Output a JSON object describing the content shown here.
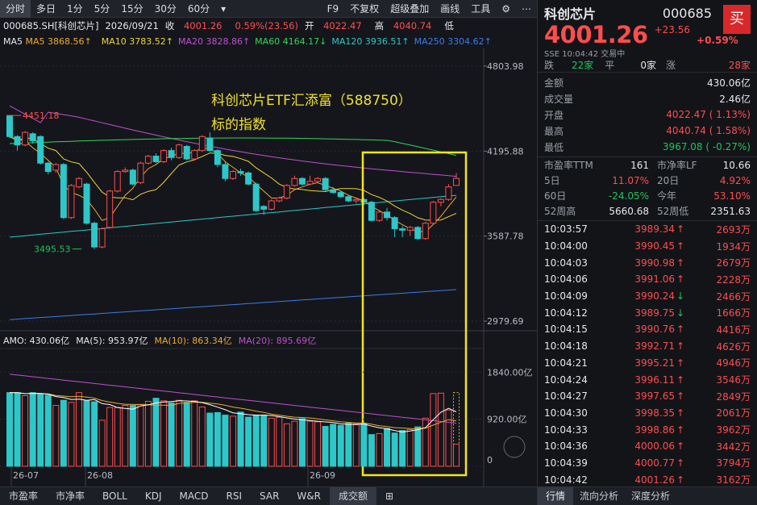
{
  "toolbar": {
    "periods": [
      "分时",
      "多日",
      "1分",
      "5分",
      "15分",
      "30分",
      "60分"
    ],
    "f9": "F9",
    "fq": "不复权",
    "overlay": "超级叠加",
    "draw": "画线",
    "tools": "工具",
    "gear": "⚙",
    "more": "⋯"
  },
  "info": {
    "code": "000685.SH[科创芯片]",
    "date": "2026/09/21",
    "close_label": "收",
    "close": "4001.26",
    "pct": "0.59%(23.56)",
    "open_label": "开",
    "open": "4022.47",
    "high_label": "高",
    "high": "4040.74",
    "low_label": "低"
  },
  "ma": {
    "ma5": "MA5 3868.56↑",
    "ma10": "MA10 3783.52↑",
    "ma20": "MA20 3828.86↑",
    "ma60": "MA60 4164.17↓",
    "ma120": "MA120 3936.51↑",
    "ma250": "MA250 3304.62↑"
  },
  "annotation": {
    "line1": "科创芯片ETF汇添富（588750）",
    "line2": "标的指数"
  },
  "chart_data": {
    "type": "candlestick",
    "y_ticks": [
      "4803.98",
      "4195.88",
      "3587.78",
      "2979.69"
    ],
    "y_values": [
      4803.98,
      4195.88,
      3587.78,
      2979.69
    ],
    "price_labels": {
      "max": "4451.18",
      "min": "3495.53"
    },
    "max_value": 4451.18,
    "min_value": 3495.53,
    "x_labels": [
      "26-07",
      "26-08",
      "26-09"
    ],
    "candles": [
      [
        4450,
        4300,
        4451,
        4290
      ],
      [
        4300,
        4240,
        4310,
        4200
      ],
      [
        4240,
        4330,
        4340,
        4230
      ],
      [
        4320,
        4270,
        4330,
        4250
      ],
      [
        4300,
        4110,
        4310,
        4100
      ],
      [
        4110,
        4050,
        4120,
        4030
      ],
      [
        4060,
        4100,
        4110,
        4040
      ],
      [
        4100,
        3720,
        4110,
        3710
      ],
      [
        3720,
        3950,
        3960,
        3710
      ],
      [
        3940,
        4000,
        4010,
        3930
      ],
      [
        3960,
        3680,
        3970,
        3670
      ],
      [
        3680,
        3510,
        3690,
        3495
      ],
      [
        3510,
        3640,
        3650,
        3500
      ],
      [
        3650,
        3910,
        3920,
        3640
      ],
      [
        3910,
        4050,
        4060,
        3900
      ],
      [
        4050,
        4060,
        4080,
        4040
      ],
      [
        4060,
        3960,
        4070,
        3950
      ],
      [
        3970,
        4110,
        4120,
        3960
      ],
      [
        4110,
        4160,
        4170,
        4100
      ],
      [
        4160,
        4120,
        4180,
        4110
      ],
      [
        4120,
        4200,
        4210,
        4110
      ],
      [
        4200,
        4150,
        4220,
        4130
      ],
      [
        4150,
        4240,
        4250,
        4140
      ],
      [
        4230,
        4140,
        4240,
        4130
      ],
      [
        4140,
        4200,
        4210,
        4130
      ],
      [
        4200,
        4300,
        4310,
        4190
      ],
      [
        4290,
        4200,
        4330,
        4190
      ],
      [
        4200,
        4100,
        4210,
        4080
      ],
      [
        4100,
        4000,
        4120,
        3980
      ],
      [
        4000,
        4050,
        4060,
        3990
      ],
      [
        4050,
        4040,
        4070,
        4020
      ],
      [
        4040,
        3960,
        4050,
        3950
      ],
      [
        3960,
        3770,
        3970,
        3760
      ],
      [
        3800,
        3780,
        3810,
        3740
      ],
      [
        3780,
        3840,
        3850,
        3770
      ],
      [
        3840,
        3860,
        3870,
        3830
      ],
      [
        3860,
        3950,
        3960,
        3850
      ],
      [
        3950,
        4000,
        4020,
        3940
      ],
      [
        4000,
        3960,
        4010,
        3950
      ],
      [
        3960,
        3980,
        4020,
        3950
      ],
      [
        3980,
        4000,
        4010,
        3970
      ],
      [
        4000,
        3920,
        4010,
        3910
      ],
      [
        3920,
        3900,
        3940,
        3890
      ],
      [
        3900,
        3870,
        3910,
        3860
      ],
      [
        3870,
        3840,
        3880,
        3830
      ],
      [
        3840,
        3850,
        3860,
        3820
      ],
      [
        3850,
        3830,
        3860,
        3810
      ],
      [
        3830,
        3700,
        3840,
        3690
      ],
      [
        3700,
        3760,
        3770,
        3690
      ],
      [
        3760,
        3720,
        3790,
        3700
      ],
      [
        3720,
        3640,
        3730,
        3580
      ],
      [
        3640,
        3630,
        3660,
        3580
      ],
      [
        3630,
        3650,
        3660,
        3590
      ],
      [
        3650,
        3570,
        3660,
        3560
      ],
      [
        3570,
        3680,
        3690,
        3560
      ],
      [
        3680,
        3830,
        3840,
        3670
      ],
      [
        3830,
        3850,
        3860,
        3800
      ],
      [
        3850,
        3940,
        3960,
        3840
      ],
      [
        3950,
        4001,
        4040,
        3967
      ]
    ],
    "ma_lines": {
      "ma5": [
        4300,
        4280,
        4270,
        4220,
        4180,
        4130,
        4080,
        3950,
        3900,
        3880,
        3850,
        3780,
        3700,
        3720,
        3800,
        3880,
        3930,
        4010,
        4070,
        4100,
        4140,
        4160,
        4180,
        4180,
        4190,
        4220,
        4210,
        4180,
        4120,
        4080,
        4040,
        4010,
        3960,
        3910,
        3860,
        3860,
        3880,
        3920,
        3940,
        3960,
        3970,
        3950,
        3930,
        3910,
        3880,
        3860,
        3840,
        3800,
        3770,
        3740,
        3700,
        3670,
        3640,
        3620,
        3620,
        3670,
        3730,
        3800,
        3868
      ]
    },
    "volume": {
      "labels": [
        "1840.00亿",
        "920.00亿",
        "0"
      ],
      "values": [
        1440,
        1440,
        1380,
        1440,
        1410,
        1390,
        1190,
        1290,
        1250,
        1440,
        1280,
        1260,
        900,
        1150,
        1150,
        1190,
        1190,
        1210,
        1270,
        1330,
        1280,
        1240,
        1290,
        1250,
        1280,
        1160,
        1040,
        1050,
        1000,
        980,
        1060,
        960,
        1000,
        1000,
        940,
        960,
        830,
        880,
        930,
        880,
        870,
        780,
        820,
        800,
        840,
        830,
        840,
        620,
        640,
        740,
        650,
        700,
        720,
        770,
        940,
        1420,
        1430,
        1100,
        430
      ],
      "up": [
        0,
        0,
        1,
        0,
        0,
        0,
        1,
        0,
        1,
        1,
        0,
        0,
        1,
        1,
        1,
        1,
        0,
        1,
        1,
        0,
        1,
        0,
        1,
        0,
        1,
        1,
        0,
        0,
        0,
        1,
        0,
        0,
        0,
        0,
        1,
        1,
        1,
        1,
        0,
        1,
        1,
        0,
        0,
        0,
        0,
        1,
        0,
        0,
        1,
        0,
        0,
        0,
        1,
        0,
        1,
        1,
        1,
        1,
        1
      ]
    }
  },
  "vol_info": {
    "amo": "AMO: 430.06亿",
    "ma5": "MA(5): 953.97亿",
    "ma10": "MA(10): 863.34亿",
    "ma20": "MA(20): 895.69亿"
  },
  "bottom_tabs": [
    "市盈率",
    "市净率",
    "BOLL",
    "KDJ",
    "MACD",
    "RSI",
    "SAR",
    "W&R",
    "成交额"
  ],
  "right": {
    "name": "科创芯片",
    "code": "000685",
    "buy": "买",
    "price": "4001.26",
    "change": "+23.56",
    "pct": "+0.59%",
    "meta": "SSE  10:04:42  交易中",
    "breadth": {
      "down_label": "跌",
      "down": "22家",
      "flat_label": "平",
      "flat": "0家",
      "up_label": "涨",
      "up": "28家"
    },
    "stats": [
      {
        "label": "金额",
        "value": "430.06亿",
        "color": "white"
      },
      {
        "label": "成交量",
        "value": "2.46亿",
        "color": "white"
      },
      {
        "label": "开盘",
        "value": "4022.47 ( 1.13%)",
        "color": "red"
      },
      {
        "label": "最高",
        "value": "4040.74 ( 1.58%)",
        "color": "red"
      },
      {
        "label": "最低",
        "value": "3967.08 ( -0.27%)",
        "color": "green"
      }
    ],
    "grid": [
      {
        "l": "市盈率TTM",
        "v": "161",
        "c": "white",
        "l2": "市净率LF",
        "v2": "10.66",
        "c2": "white"
      },
      {
        "l": "5日",
        "v": "11.07%",
        "c": "red",
        "l2": "20日",
        "v2": "4.92%",
        "c2": "red"
      },
      {
        "l": "60日",
        "v": "-24.05%",
        "c": "green",
        "l2": "今年",
        "v2": "53.10%",
        "c2": "red"
      },
      {
        "l": "52周高",
        "v": "5660.68",
        "c": "white",
        "l2": "52周低",
        "v2": "2351.63",
        "c2": "white"
      }
    ],
    "ticks": [
      {
        "t": "10:03:57",
        "p": "3989.34",
        "d": "↑",
        "dc": "red",
        "v": "2693万"
      },
      {
        "t": "10:04:00",
        "p": "3990.45",
        "d": "↑",
        "dc": "red",
        "v": "1934万"
      },
      {
        "t": "10:04:03",
        "p": "3990.98",
        "d": "↑",
        "dc": "red",
        "v": "2679万"
      },
      {
        "t": "10:04:06",
        "p": "3991.06",
        "d": "↑",
        "dc": "red",
        "v": "2228万"
      },
      {
        "t": "10:04:09",
        "p": "3990.24",
        "d": "↓",
        "dc": "green",
        "v": "2466万"
      },
      {
        "t": "10:04:12",
        "p": "3989.75",
        "d": "↓",
        "dc": "green",
        "v": "1666万"
      },
      {
        "t": "10:04:15",
        "p": "3990.76",
        "d": "↑",
        "dc": "red",
        "v": "4416万"
      },
      {
        "t": "10:04:18",
        "p": "3992.71",
        "d": "↑",
        "dc": "red",
        "v": "4626万"
      },
      {
        "t": "10:04:21",
        "p": "3995.21",
        "d": "↑",
        "dc": "red",
        "v": "4946万"
      },
      {
        "t": "10:04:24",
        "p": "3996.11",
        "d": "↑",
        "dc": "red",
        "v": "3546万"
      },
      {
        "t": "10:04:27",
        "p": "3997.65",
        "d": "↑",
        "dc": "red",
        "v": "2849万"
      },
      {
        "t": "10:04:30",
        "p": "3998.35",
        "d": "↑",
        "dc": "red",
        "v": "2061万"
      },
      {
        "t": "10:04:33",
        "p": "3998.86",
        "d": "↑",
        "dc": "red",
        "v": "3962万"
      },
      {
        "t": "10:04:36",
        "p": "4000.06",
        "d": "↑",
        "dc": "red",
        "v": "3442万"
      },
      {
        "t": "10:04:39",
        "p": "4000.77",
        "d": "↑",
        "dc": "red",
        "v": "3794万"
      },
      {
        "t": "10:04:42",
        "p": "4001.26",
        "d": "↑",
        "dc": "red",
        "v": "3162万"
      }
    ],
    "tabs": [
      "行情",
      "流向分析",
      "深度分析"
    ]
  }
}
